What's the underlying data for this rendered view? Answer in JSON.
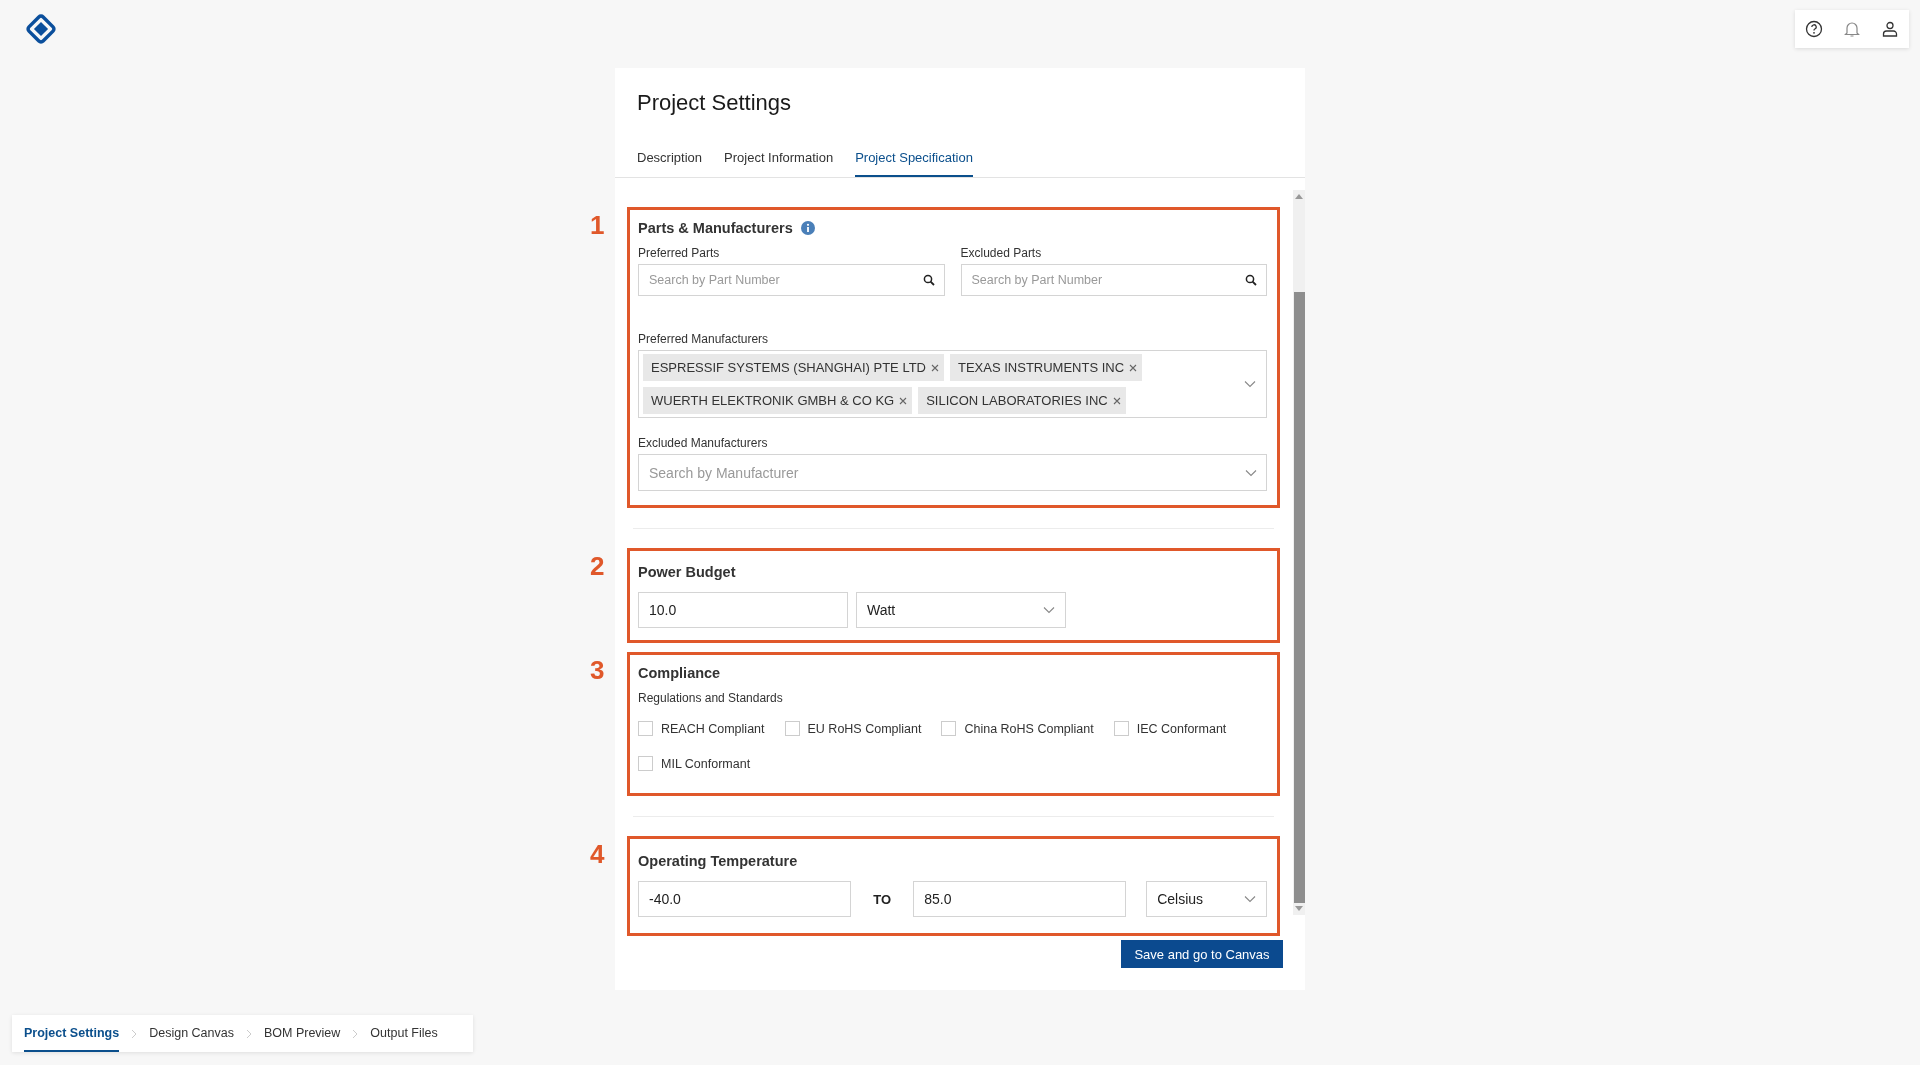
{
  "page_title": "Project Settings",
  "tabs": [
    {
      "label": "Description",
      "selected": false
    },
    {
      "label": "Project Information",
      "selected": false
    },
    {
      "label": "Project Specification",
      "selected": true
    }
  ],
  "sections": [
    {
      "number": "1",
      "kind": "parts",
      "title": "Parts & Manufacturers",
      "divider_after": true,
      "preferred_parts": {
        "label": "Preferred Parts",
        "placeholder": "Search by Part Number"
      },
      "excluded_parts": {
        "label": "Excluded Parts",
        "placeholder": "Search by Part Number"
      },
      "preferred_manufacturers": {
        "label": "Preferred Manufacturers",
        "tags": [
          "ESPRESSIF SYSTEMS (SHANGHAI) PTE LTD",
          "TEXAS INSTRUMENTS INC",
          "WUERTH ELEKTRONIK GMBH & CO KG",
          "SILICON LABORATORIES INC"
        ]
      },
      "excluded_manufacturers": {
        "label": "Excluded Manufacturers",
        "placeholder": "Search by Manufacturer"
      }
    },
    {
      "number": "2",
      "kind": "power",
      "title": "Power Budget",
      "divider_after": false,
      "value": "10.0",
      "unit": "Watt"
    },
    {
      "number": "3",
      "kind": "compliance",
      "title": "Compliance",
      "divider_after": true,
      "subtitle": "Regulations and Standards",
      "options": [
        {
          "label": "REACH Compliant",
          "checked": false
        },
        {
          "label": "EU RoHS Compliant",
          "checked": false
        },
        {
          "label": "China RoHS Compliant",
          "checked": false
        },
        {
          "label": "IEC Conformant",
          "checked": false
        },
        {
          "label": "MIL Conformant",
          "checked": false
        }
      ]
    },
    {
      "number": "4",
      "kind": "temperature",
      "title": "Operating Temperature",
      "divider_after": false,
      "min": "-40.0",
      "separator": "TO",
      "max": "85.0",
      "unit": "Celsius"
    }
  ],
  "save_button": "Save and go to Canvas",
  "breadcrumb": [
    {
      "label": "Project Settings",
      "selected": true
    },
    {
      "label": "Design Canvas",
      "selected": false
    },
    {
      "label": "BOM Preview",
      "selected": false
    },
    {
      "label": "Output Files",
      "selected": false
    }
  ]
}
